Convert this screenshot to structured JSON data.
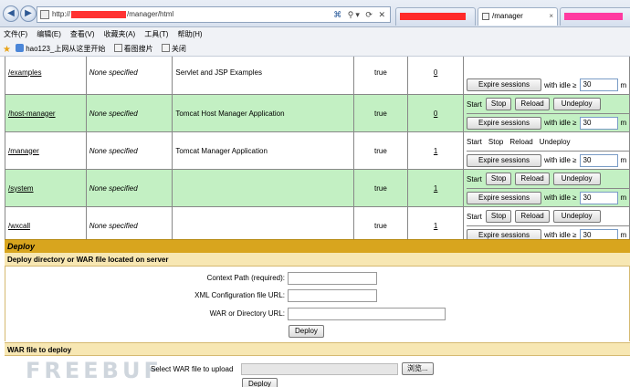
{
  "browser": {
    "url_prefix": "http://",
    "url_suffix": "/manager/html",
    "active_tab": "/manager"
  },
  "menu": [
    "文件(F)",
    "编辑(E)",
    "查看(V)",
    "收藏夹(A)",
    "工具(T)",
    "帮助(H)"
  ],
  "favorites": [
    "hao123_上网从这里开始",
    "看图搜片",
    "关闭"
  ],
  "apps": [
    {
      "path": "/examples",
      "display": "None specified",
      "name": "Servlet and JSP Examples",
      "running": "true",
      "sessions": "0",
      "style": "white",
      "commands_plain": false
    },
    {
      "path": "/host-manager",
      "display": "None specified",
      "name": "Tomcat Host Manager Application",
      "running": "true",
      "sessions": "0",
      "style": "green",
      "commands_plain": false
    },
    {
      "path": "/manager",
      "display": "None specified",
      "name": "Tomcat Manager Application",
      "running": "true",
      "sessions": "1",
      "style": "white",
      "commands_plain": true
    },
    {
      "path": "/system",
      "display": "None specified",
      "name": "",
      "running": "true",
      "sessions": "1",
      "style": "green",
      "commands_plain": false
    },
    {
      "path": "/wxcall",
      "display": "None specified",
      "name": "",
      "running": "true",
      "sessions": "1",
      "style": "white",
      "commands_plain": false
    }
  ],
  "commands": {
    "start": "Start",
    "stop": "Stop",
    "reload": "Reload",
    "undeploy": "Undeploy",
    "expire": "Expire sessions",
    "idle_label": "with idle ≥",
    "idle_value": "30",
    "idle_after": "m"
  },
  "deploy": {
    "title": "Deploy",
    "subtitle": "Deploy directory or WAR file located on server",
    "context_path_label": "Context Path (required):",
    "xml_config_label": "XML Configuration file URL:",
    "war_dir_label": "WAR or Directory URL:",
    "deploy_button": "Deploy",
    "war_section_title": "WAR file to deploy",
    "select_war_label": "Select WAR file to upload",
    "browse_button": "浏览...",
    "upload_deploy_button": "Deploy"
  },
  "watermark": "FREEBUF"
}
